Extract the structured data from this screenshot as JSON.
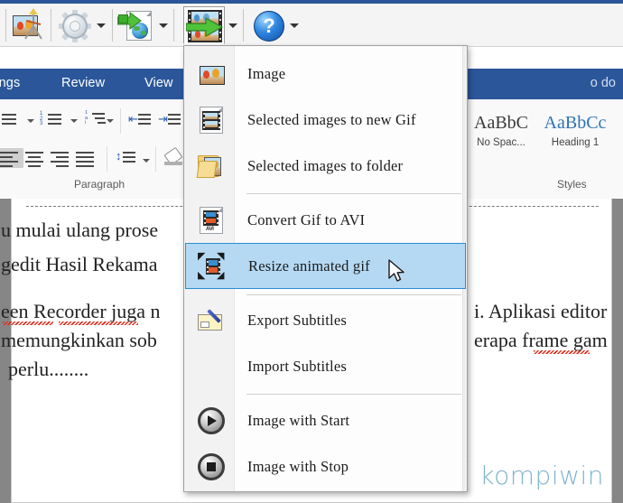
{
  "app": {
    "toolbar": {
      "buttons": [
        {
          "name": "capture-editor-button",
          "icon": "image-easel-icon",
          "has_dropdown": false
        },
        {
          "name": "settings-button",
          "icon": "gear-icon",
          "has_dropdown": true
        },
        {
          "name": "publish-to-web-button",
          "icon": "page-globe-arrow-icon",
          "has_dropdown": true
        },
        {
          "name": "export-gif-button",
          "icon": "filmstrip-green-arrow-icon",
          "has_dropdown": true,
          "active": true
        },
        {
          "name": "help-button",
          "icon": "question-mark-icon",
          "has_dropdown": true
        }
      ]
    },
    "menu": {
      "name": "export-gif-dropdown-menu",
      "items": [
        {
          "label": "Image",
          "icon": "photo-icon",
          "selected": false,
          "separator_after": false
        },
        {
          "label": "Selected images to new Gif",
          "icon": "film-page-icon",
          "selected": false,
          "separator_after": false
        },
        {
          "label": "Selected images to folder",
          "icon": "folder-image-icon",
          "selected": false,
          "separator_after": true
        },
        {
          "label": "Convert Gif to AVI",
          "icon": "avi-page-icon",
          "selected": false,
          "separator_after": false
        },
        {
          "label": "Resize animated gif",
          "icon": "resize-gif-icon",
          "selected": true,
          "separator_after": true
        },
        {
          "label": "Export Subtitles",
          "icon": "subtitle-edit-icon",
          "selected": false,
          "separator_after": false
        },
        {
          "label": "Import Subtitles",
          "icon": "",
          "selected": false,
          "separator_after": true
        },
        {
          "label": "Image with Start",
          "icon": "play-circle-icon",
          "selected": false,
          "separator_after": false
        },
        {
          "label": "Image with Stop",
          "icon": "stop-circle-icon",
          "selected": false,
          "separator_after": false
        }
      ]
    },
    "colors": {
      "menu_highlight_fill": "#b5d9f3",
      "menu_highlight_border": "#2a8dd4",
      "ribbon_blue": "#2b579a",
      "watermark_blue": "#7fb4cc"
    }
  },
  "word": {
    "ribbon": {
      "tabs": [
        {
          "label": "lings"
        },
        {
          "label": "Review"
        },
        {
          "label": "View"
        }
      ],
      "tell_me": "o do",
      "groups": [
        {
          "label": "Paragraph"
        },
        {
          "label": "Styles"
        }
      ],
      "styles": [
        {
          "preview": "AaBbC",
          "name": "No Spac..."
        },
        {
          "preview": "AaBbCс",
          "name": "Heading 1"
        }
      ]
    },
    "document": {
      "lines": [
        "u mulai ulang prose",
        "gedit Hasil Rekama",
        "een Recorder juga n",
        "memungkinkan sob",
        "perlu........",
        "i. Aplikasi editor",
        "erapa frame gam"
      ],
      "watermark": "kompiwin"
    }
  }
}
